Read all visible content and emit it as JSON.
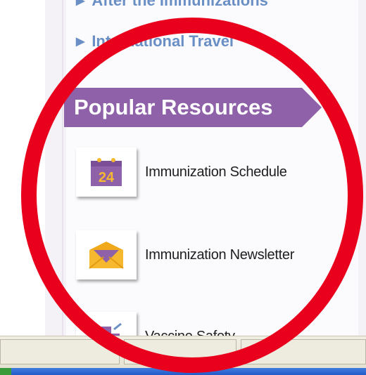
{
  "nav": {
    "items": [
      {
        "label": "After the Immunizations"
      },
      {
        "label": "International Travel"
      }
    ]
  },
  "popular": {
    "title": "Popular Resources",
    "items": [
      {
        "label": "Immunization Schedule",
        "icon": "calendar-icon",
        "calendar_day": "24"
      },
      {
        "label": "Immunization Newsletter",
        "icon": "envelope-icon"
      },
      {
        "label": "Vaccine Safety",
        "icon": "vaccine-safety-icon"
      }
    ]
  },
  "colors": {
    "accent_purple": "#8e61a9",
    "link_blue": "#6a8fc4",
    "annotation_red": "#e8001c",
    "envelope_orange": "#f5b82e"
  }
}
